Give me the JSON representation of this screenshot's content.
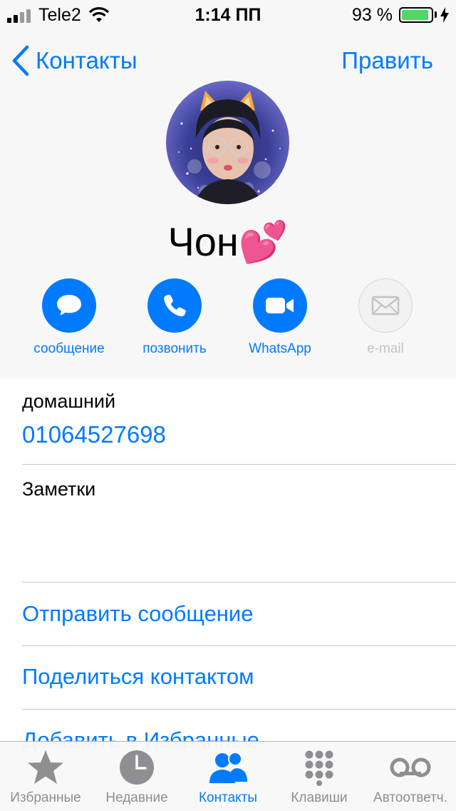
{
  "status_bar": {
    "carrier": "Tele2",
    "time": "1:14 ПП",
    "battery_percent": "93 %",
    "battery_level": 0.93
  },
  "nav": {
    "back_label": "Контакты",
    "edit_label": "Править"
  },
  "contact": {
    "name": "Чон💕"
  },
  "actions": [
    {
      "label": "сообщение",
      "icon": "message-icon",
      "enabled": true
    },
    {
      "label": "позвонить",
      "icon": "phone-icon",
      "enabled": true
    },
    {
      "label": "WhatsApp",
      "icon": "video-icon",
      "enabled": true
    },
    {
      "label": "e-mail",
      "icon": "mail-icon",
      "enabled": false
    }
  ],
  "phone": {
    "label": "домашний",
    "value": "01064527698"
  },
  "notes": {
    "label": "Заметки"
  },
  "links": {
    "send_message": "Отправить сообщение",
    "share_contact": "Поделиться контактом",
    "add_favorite": "Добавить в Избранные"
  },
  "tabs": [
    {
      "label": "Избранные",
      "icon": "star-icon",
      "active": false
    },
    {
      "label": "Недавние",
      "icon": "clock-icon",
      "active": false
    },
    {
      "label": "Контакты",
      "icon": "contacts-icon",
      "active": true
    },
    {
      "label": "Клавиши",
      "icon": "keypad-icon",
      "active": false
    },
    {
      "label": "Автоответч.",
      "icon": "voicemail-icon",
      "active": false
    }
  ],
  "colors": {
    "accent": "#007aff",
    "battery": "#4cd964",
    "inactive": "#8e8e93",
    "disabled": "#c4c4c4"
  }
}
